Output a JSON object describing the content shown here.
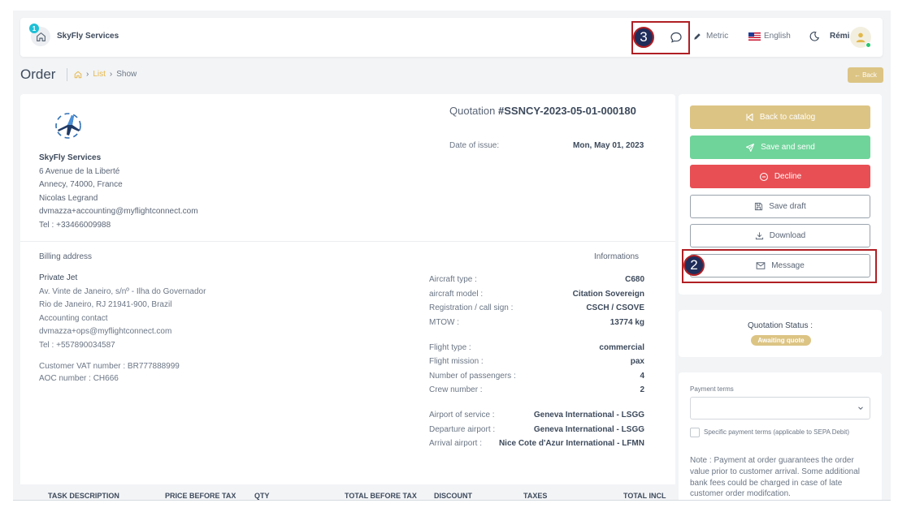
{
  "navbar": {
    "notification_count": "1",
    "brand": "SkyFly Services",
    "metric_label": "Metric",
    "language_label": "English",
    "user_name": "Rémi"
  },
  "page": {
    "title": "Order",
    "breadcrumb": {
      "list": "List",
      "current": "Show"
    },
    "back_label": "Back"
  },
  "seller": {
    "name": "SkyFly Services",
    "lines": [
      "6 Avenue de la Liberté",
      "Annecy,  74000,  France",
      "Nicolas Legrand",
      "dvmazza+accounting@myflightconnect.com",
      "Tel : +33466009988"
    ]
  },
  "quotation": {
    "title_prefix": "Quotation ",
    "number": "#SSNCY-2023-05-01-000180",
    "issue_label": "Date of issue:",
    "issue_date": "Mon, May 01, 2023"
  },
  "billing": {
    "heading": "Billing address",
    "name": "Private Jet",
    "lines": [
      "Av. Vinte de Janeiro, s/nº - Ilha do Governador",
      "Rio de Janeiro,  RJ 21941-900,  Brazil",
      "Accounting contact",
      "dvmazza+ops@myflightconnect.com",
      "Tel : +557890034587"
    ],
    "vat": "Customer VAT number : BR777888999",
    "aoc": "AOC number : CH666"
  },
  "informations": {
    "heading": "Informations",
    "groups": [
      [
        {
          "k": "Aircraft type :",
          "v": "C680"
        },
        {
          "k": "aircraft model :",
          "v": "Citation Sovereign"
        },
        {
          "k": "Registration / call sign :",
          "v": "CSCH / CSOVE"
        },
        {
          "k": "MTOW :",
          "v": "13774 kg"
        }
      ],
      [
        {
          "k": "Flight type :",
          "v": "commercial"
        },
        {
          "k": "Flight mission :",
          "v": "pax"
        },
        {
          "k": "Number of passengers :",
          "v": "4"
        },
        {
          "k": "Crew number :",
          "v": "2"
        }
      ],
      [
        {
          "k": "Airport of service :",
          "v": "Geneva International - LSGG"
        },
        {
          "k": "Departure airport :",
          "v": "Geneva International - LSGG"
        },
        {
          "k": "Arrival airport :",
          "v": "Nice Cote d'Azur International - LFMN"
        }
      ]
    ]
  },
  "table": {
    "headers": [
      "TASK DESCRIPTION",
      "PRICE BEFORE TAX",
      "QTY",
      "TOTAL BEFORE TAX",
      "DISCOUNT",
      "TAXES",
      "TOTAL INCL"
    ]
  },
  "actions": {
    "back_to_catalog": "Back to catalog",
    "save_and_send": "Save and send",
    "decline": "Decline",
    "save_draft": "Save draft",
    "download": "Download",
    "message": "Message"
  },
  "status": {
    "label": "Quotation Status :",
    "value": "Awaiting quote"
  },
  "payment": {
    "label": "Payment terms",
    "select_value": "",
    "checkbox_label": "Specific payment terms (applicable to SEPA Debit)",
    "note": "Note : Payment at order guarantees the order value prior to customer arrival. Some additional bank fees could be charged in case of late customer order modifcation."
  },
  "annotations": {
    "message_marker": "2",
    "chat_marker": "3"
  },
  "colors": {
    "gold": "#dcc484",
    "green": "#6fd49a",
    "red": "#e84f54",
    "annotation": "#b01f24",
    "annotation_fill": "#1f2d5a"
  }
}
